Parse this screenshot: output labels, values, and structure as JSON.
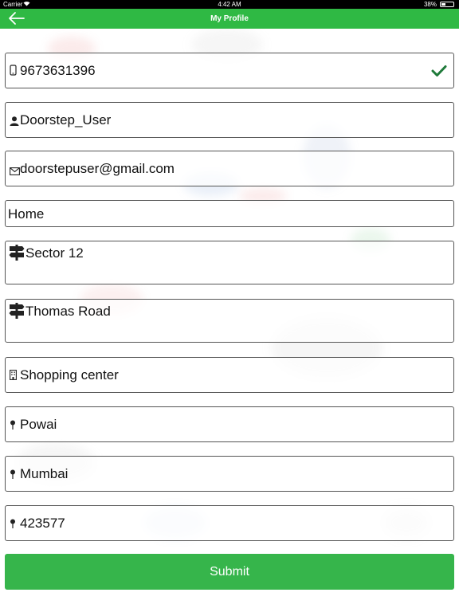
{
  "status_bar": {
    "carrier": "Carrier",
    "time": "4:42 AM",
    "battery": "38%",
    "battery_level": 0.38
  },
  "nav": {
    "title": "My Profile",
    "back_icon": "arrow-left-icon",
    "color": "#2fb944"
  },
  "form": {
    "mobile": {
      "value": "9673631396",
      "icon": "phone-icon",
      "verified_icon": "checkmark-icon"
    },
    "name": {
      "value": "Doorstep_User",
      "icon": "user-icon"
    },
    "email": {
      "value": "doorstepuser@gmail.com",
      "icon": "envelope-icon"
    },
    "address_type": {
      "value": "Home"
    },
    "address_line1": {
      "value": "Sector 12",
      "icon": "signpost-icon"
    },
    "address_line2": {
      "value": "Thomas Road",
      "icon": "signpost-icon"
    },
    "landmark": {
      "value": "Shopping center",
      "icon": "building-icon"
    },
    "area": {
      "value": "Powai",
      "icon": "pin-icon"
    },
    "city": {
      "value": "Mumbai",
      "icon": "pin-icon"
    },
    "pincode": {
      "value": "423577",
      "icon": "pin-icon"
    }
  },
  "submit": {
    "label": "Submit",
    "color": "#36b54b"
  }
}
